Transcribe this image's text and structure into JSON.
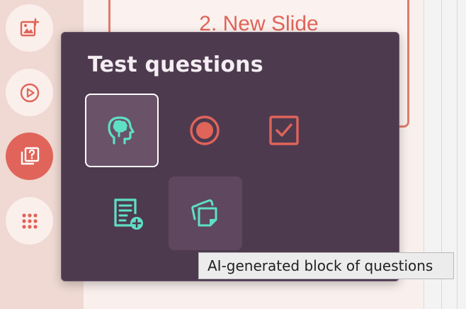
{
  "slide": {
    "title": "2. New Slide"
  },
  "sidebar": {
    "buttons": [
      {
        "icon": "add-image-icon"
      },
      {
        "icon": "play-icon"
      },
      {
        "icon": "quiz-icon",
        "active": true
      },
      {
        "icon": "grid-dots-icon"
      }
    ]
  },
  "popup": {
    "title": "Test questions",
    "items": [
      {
        "icon": "ai-head-icon",
        "selected": true
      },
      {
        "icon": "radio-icon"
      },
      {
        "icon": "checkbox-icon"
      },
      {
        "icon": "document-add-icon"
      },
      {
        "icon": "stacked-cards-icon",
        "hovered": true
      }
    ]
  },
  "tooltip": {
    "text": "AI-generated block of questions"
  },
  "colors": {
    "accent": "#e0645a",
    "teal": "#5ee0c5",
    "popup_bg": "#4e3a4f"
  }
}
